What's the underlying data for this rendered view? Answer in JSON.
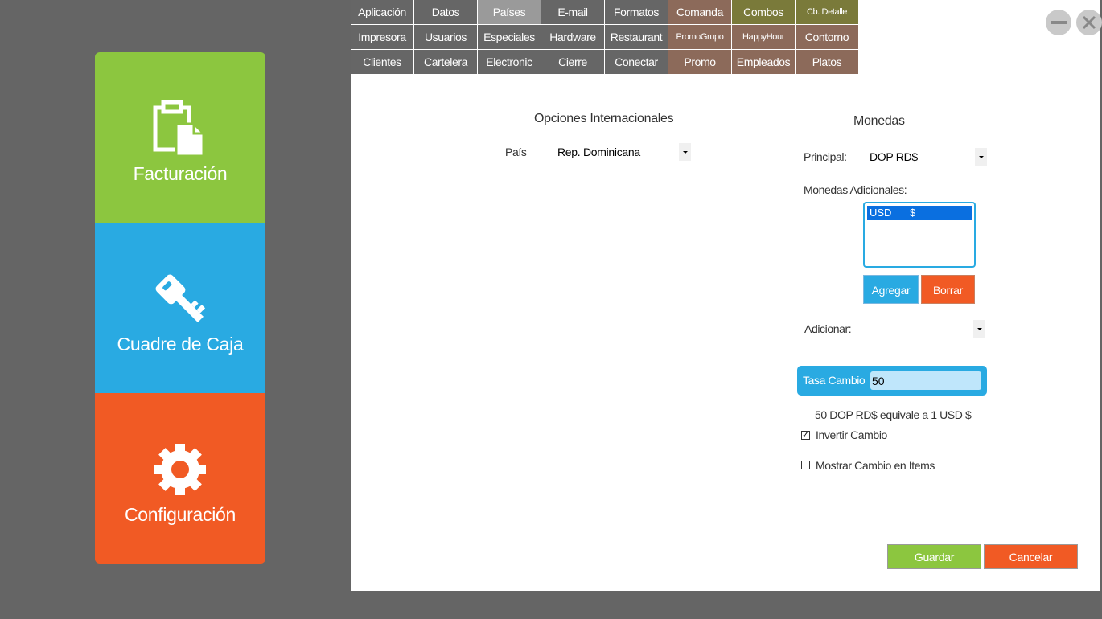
{
  "sidebar": {
    "items": [
      {
        "label": "Facturación",
        "icon": "clipboard-icon",
        "color": "#8cc63f"
      },
      {
        "label": "Cuadre de Caja",
        "icon": "key-icon",
        "color": "#29aae2"
      },
      {
        "label": "Configuración",
        "icon": "gear-icon",
        "color": "#f15a24"
      }
    ]
  },
  "tabs": {
    "row1": [
      "Aplicación",
      "Datos",
      "Países",
      "E-mail",
      "Formatos",
      "Comanda",
      "Combos",
      "Cb. Detalle"
    ],
    "row2": [
      "Impresora",
      "Usuarios",
      "Especiales",
      "Hardware",
      "Restaurant",
      "PromoGrupo",
      "HappyHour",
      "Contorno"
    ],
    "row3": [
      "Clientes",
      "Cartelera",
      "Electronic",
      "Cierre",
      "Conectar",
      "Promo",
      "Empleados",
      "Platos"
    ],
    "active": "Países"
  },
  "international": {
    "title": "Opciones Internacionales",
    "country_label": "País",
    "country_value": "Rep. Dominicana"
  },
  "currencies": {
    "title": "Monedas",
    "principal_label": "Principal:",
    "principal_value": "DOP RD$",
    "additional_label": "Monedas Adicionales:",
    "list": [
      {
        "code": "USD",
        "symbol": "$"
      }
    ],
    "add_label": "Agregar",
    "delete_label": "Borrar",
    "adicionar_label": "Adicionar:",
    "adicionar_value": ""
  },
  "exchange": {
    "label": "Tasa Cambio",
    "value": "50",
    "equivalence": "50 DOP RD$ equivale a 1 USD $",
    "invert_label": "Invertir Cambio",
    "invert_checked": true,
    "show_items_label": "Mostrar Cambio en Items",
    "show_items_checked": false
  },
  "actions": {
    "save_label": "Guardar",
    "cancel_label": "Cancelar"
  },
  "colors": {
    "green": "#8cc63f",
    "blue": "#29aae2",
    "orange": "#f15a24"
  }
}
